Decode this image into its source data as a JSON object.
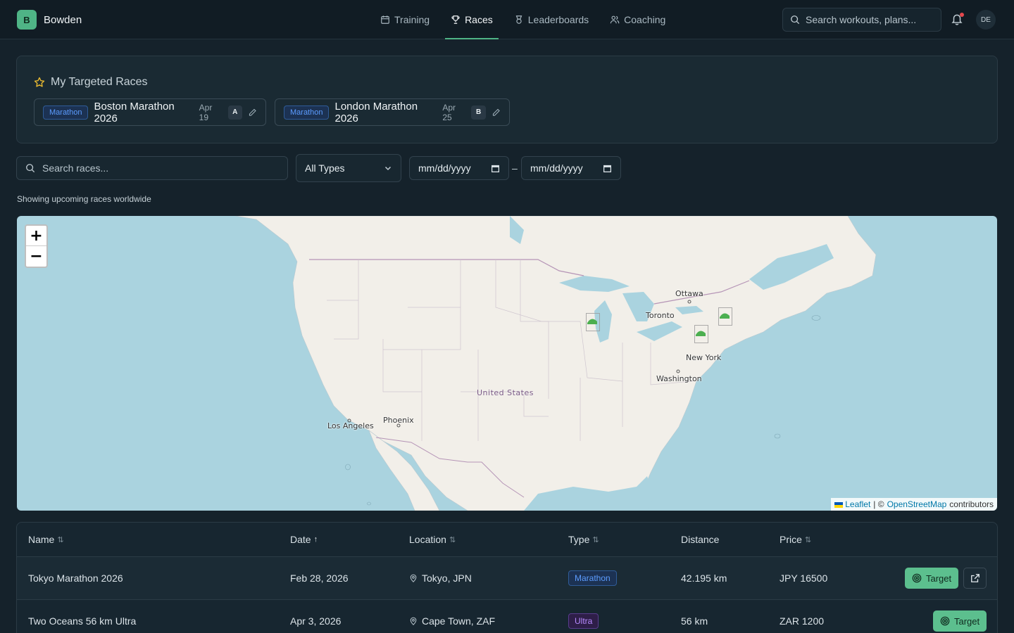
{
  "brand": {
    "initial": "B",
    "name": "Bowden"
  },
  "nav": [
    {
      "label": "Training",
      "icon": "calendar-icon"
    },
    {
      "label": "Races",
      "icon": "trophy-icon",
      "active": true
    },
    {
      "label": "Leaderboards",
      "icon": "medal-icon"
    },
    {
      "label": "Coaching",
      "icon": "users-icon"
    }
  ],
  "top_search": {
    "placeholder": "Search workouts, plans..."
  },
  "user": {
    "initials": "DE"
  },
  "targeted": {
    "title": "My Targeted Races",
    "races": [
      {
        "type": "Marathon",
        "name": "Boston Marathon 2026",
        "date": "Apr 19",
        "priority": "A"
      },
      {
        "type": "Marathon",
        "name": "London Marathon 2026",
        "date": "Apr 25",
        "priority": "B"
      }
    ]
  },
  "filters": {
    "search_placeholder": "Search races...",
    "type_value": "All Types",
    "date_from": "mm/dd/yyyy",
    "date_to": "mm/dd/yyyy",
    "separator": "–"
  },
  "showing_text": "Showing upcoming races worldwide",
  "map": {
    "zoom_in": "+",
    "zoom_out": "−",
    "labels": {
      "ottawa": "Ottawa",
      "toronto": "Toronto",
      "new_york": "New York",
      "washington": "Washington",
      "united_states": "United States",
      "phoenix": "Phoenix",
      "los_angeles": "Los Angeles"
    },
    "attribution": {
      "leaflet": "Leaflet",
      "sep": "| ©",
      "osm": "OpenStreetMap",
      "suffix": "contributors"
    }
  },
  "table": {
    "headers": {
      "name": "Name",
      "date": "Date",
      "location": "Location",
      "type": "Type",
      "distance": "Distance",
      "price": "Price"
    },
    "rows": [
      {
        "name": "Tokyo Marathon 2026",
        "date": "Feb 28, 2026",
        "location": "Tokyo, JPN",
        "type": "Marathon",
        "distance": "42.195 km",
        "price": "JPY 16500",
        "action": "Target"
      },
      {
        "name": "Two Oceans 56 km Ultra",
        "date": "Apr 3, 2026",
        "location": "Cape Town, ZAF",
        "type": "Ultra",
        "distance": "56 km",
        "price": "ZAR 1200",
        "action": "Target"
      }
    ]
  },
  "colors": {
    "accent": "#4fb486",
    "marathon": "#5c9cff",
    "ultra": "#b78bff",
    "background": "#15222b"
  }
}
